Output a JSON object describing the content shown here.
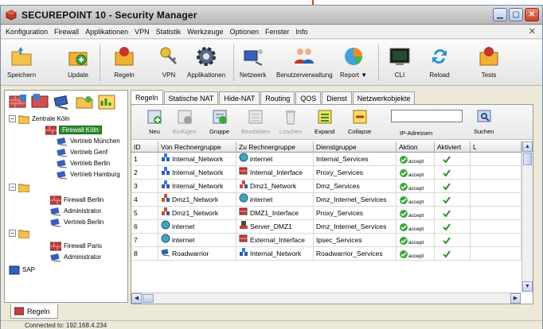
{
  "window": {
    "title": "SECUREPOINT 10 - Security Manager"
  },
  "menu": [
    "Konfiguration",
    "Firewall",
    "Applikationen",
    "VPN",
    "Statistik",
    "Werkzeuge",
    "Optionen",
    "Fenster",
    "Info"
  ],
  "toolbar": {
    "speichern": "Speichern",
    "update": "Update",
    "regeln": "Regeln",
    "vpn": "VPN",
    "applikationen": "Applikationen",
    "netzwerk": "Netzwerk",
    "benutzerverwaltung": "Benutzerverwaltung",
    "report": "Report",
    "cli": "CLI",
    "reload": "Reload",
    "tests": "Tests"
  },
  "tree": {
    "group1": "Zentrale Köln",
    "firewall_koeln": "Firewall Köln",
    "vertrieb_muenchen": "Vertrieb München",
    "vertrieb_genf": "Vertrieb Genf",
    "vertrieb_berlin": "Vertrieb Berlin",
    "vertrieb_hamburg": "Vertrieb Hamburg",
    "firewall_berlin": "Firewall Berlin",
    "administrator": "Administrator",
    "vertrieb_berlin2": "Vertrieb Berlin",
    "firewall_paris": "Firewall Paris",
    "administrator2": "Administrator",
    "sap": "SAP"
  },
  "tabs": [
    "Regeln",
    "Statische NAT",
    "Hide-NAT",
    "Routing",
    "QOS",
    "Dienst",
    "Netzwerkobjekte"
  ],
  "subtoolbar": {
    "neu": "Neu",
    "einfuegen": "Einfügen",
    "gruppe": "Gruppe",
    "bearbeiten": "Bearbeiten",
    "loeschen": "Löschen",
    "expand": "Expand",
    "collapse": "Collapse",
    "search_label": "IP-Adressen",
    "suchen": "Suchen",
    "search_value": ""
  },
  "table": {
    "headers": [
      "ID",
      "Von Rechnergruppe",
      "Zu Rechnergruppe",
      "Dienstgruppe",
      "Aktion",
      "Aktiviert",
      "L"
    ],
    "accept_label": "accept",
    "rows": [
      {
        "id": "1",
        "von": "Internal_Network",
        "zu": "internet",
        "dienst": "Internal_Services"
      },
      {
        "id": "2",
        "von": "Internal_Network",
        "zu": "Internal_Interface",
        "dienst": "Proxy_Services"
      },
      {
        "id": "3",
        "von": "Internal_Network",
        "zu": "Dmz1_Network",
        "dienst": "Dmz_Services"
      },
      {
        "id": "4",
        "von": "Dmz1_Network",
        "zu": "internet",
        "dienst": "Dmz_Internet_Services"
      },
      {
        "id": "5",
        "von": "Dmz1_Network",
        "zu": "DMZ1_Interface",
        "dienst": "Proxy_Services"
      },
      {
        "id": "6",
        "von": "internet",
        "zu": "Server_DMZ1",
        "dienst": "Dmz_Internet_Services"
      },
      {
        "id": "7",
        "von": "internet",
        "zu": "External_Interface",
        "dienst": "Ipsec_Services"
      },
      {
        "id": "8",
        "von": "Roadwarrior",
        "zu": "Internal_Network",
        "dienst": "Roadwarrior_Services"
      }
    ]
  },
  "bottom_tab": "Regeln",
  "status": "Connected to: 192.168.4.234"
}
